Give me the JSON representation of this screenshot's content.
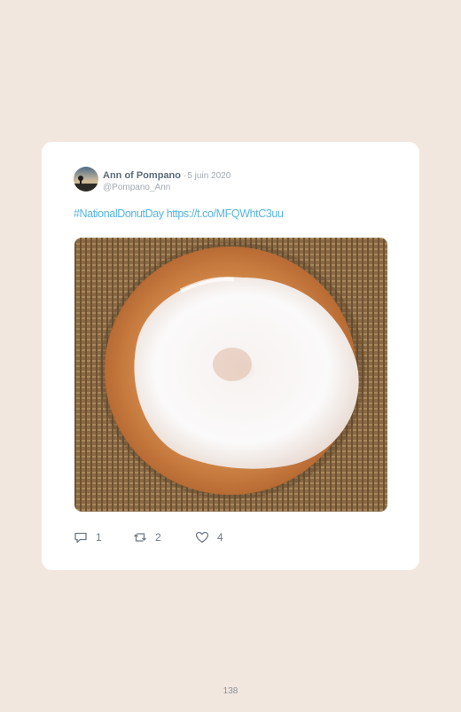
{
  "tweet": {
    "author_name": "Ann of Pompano",
    "separator": "·",
    "date": "5 juin 2020",
    "handle": "@Pompano_Ann",
    "hashtag": "#NationalDonutDay",
    "link": "https://t.co/MFQWhtC3uu",
    "image_description": "glazed-donut-photo",
    "actions": {
      "reply_count": "1",
      "retweet_count": "2",
      "like_count": "4"
    }
  },
  "page": {
    "number": "138"
  },
  "colors": {
    "background": "#f2e7df",
    "card": "#ffffff",
    "link": "#56b6e3",
    "muted": "#a3aab2"
  }
}
